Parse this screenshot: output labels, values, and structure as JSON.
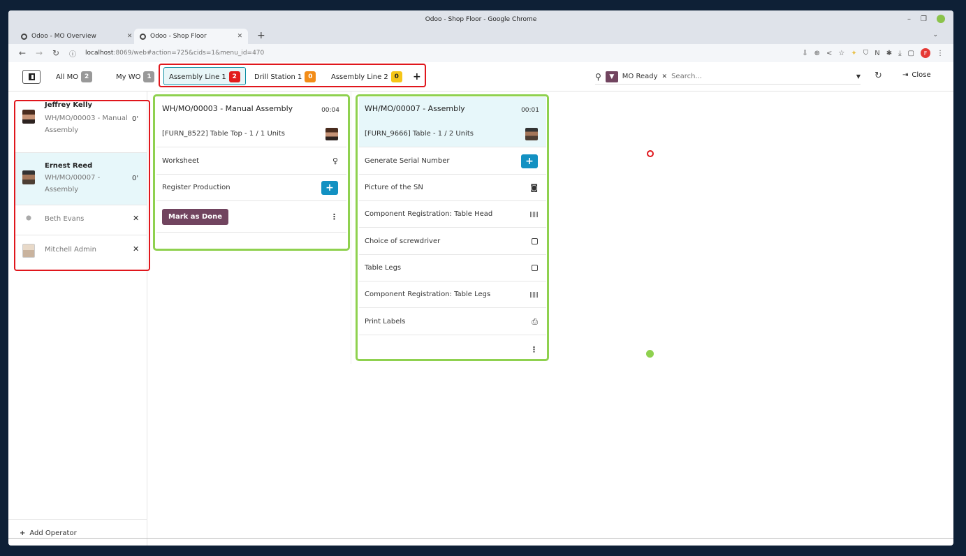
{
  "window": {
    "title": "Odoo - Shop Floor - Google Chrome"
  },
  "browser_tabs": [
    {
      "label": "Odoo - MO Overview"
    },
    {
      "label": "Odoo - Shop Floor"
    }
  ],
  "address_bar": {
    "host": "localhost",
    "path": ":8069/web#action=725&cids=1&menu_id=470",
    "profile_initial": "F"
  },
  "filters": [
    {
      "label": "All MO",
      "count": "2"
    },
    {
      "label": "My WO",
      "count": "1"
    },
    {
      "label": "Assembly Line 1",
      "count": "2"
    },
    {
      "label": "Drill Station 1",
      "count": "0"
    },
    {
      "label": "Assembly Line 2",
      "count": "0"
    }
  ],
  "add_filter_label": "+",
  "search": {
    "facet": "MO Ready",
    "placeholder": "Search..."
  },
  "close_label": "Close",
  "operators": [
    {
      "name": "Jeffrey Kelly",
      "workorder": "WH/MO/00003 - Manual Assembly",
      "time": "0'"
    },
    {
      "name": "Ernest Reed",
      "workorder": "WH/MO/00007 - Assembly",
      "time": "0'"
    },
    {
      "name": "Beth Evans"
    },
    {
      "name": "Mitchell Admin"
    }
  ],
  "add_operator_label": "Add Operator",
  "cards": [
    {
      "title": "WH/MO/00003 - Manual Assembly",
      "timer": "00:04",
      "product": "[FURN_8522] Table Top - 1 / 1 Units",
      "steps": [
        {
          "label": "Worksheet"
        },
        {
          "label": "Register Production"
        }
      ],
      "done_label": "Mark as Done"
    },
    {
      "title": "WH/MO/00007 - Assembly",
      "timer": "00:01",
      "product": "[FURN_9666] Table - 1 / 2 Units",
      "steps": [
        {
          "label": "Generate Serial Number"
        },
        {
          "label": "Picture of the SN"
        },
        {
          "label": "Component Registration: Table Head"
        },
        {
          "label": "Choice of screwdriver"
        },
        {
          "label": "Table Legs"
        },
        {
          "label": "Component Registration: Table Legs"
        },
        {
          "label": "Print Labels"
        }
      ]
    }
  ],
  "colors": {
    "annotation_red": "#e0161c",
    "annotation_green": "#8fd14f",
    "odoo_primary": "#71445f",
    "odoo_action": "#1391c2",
    "selected_row": "#e7f7fa"
  }
}
